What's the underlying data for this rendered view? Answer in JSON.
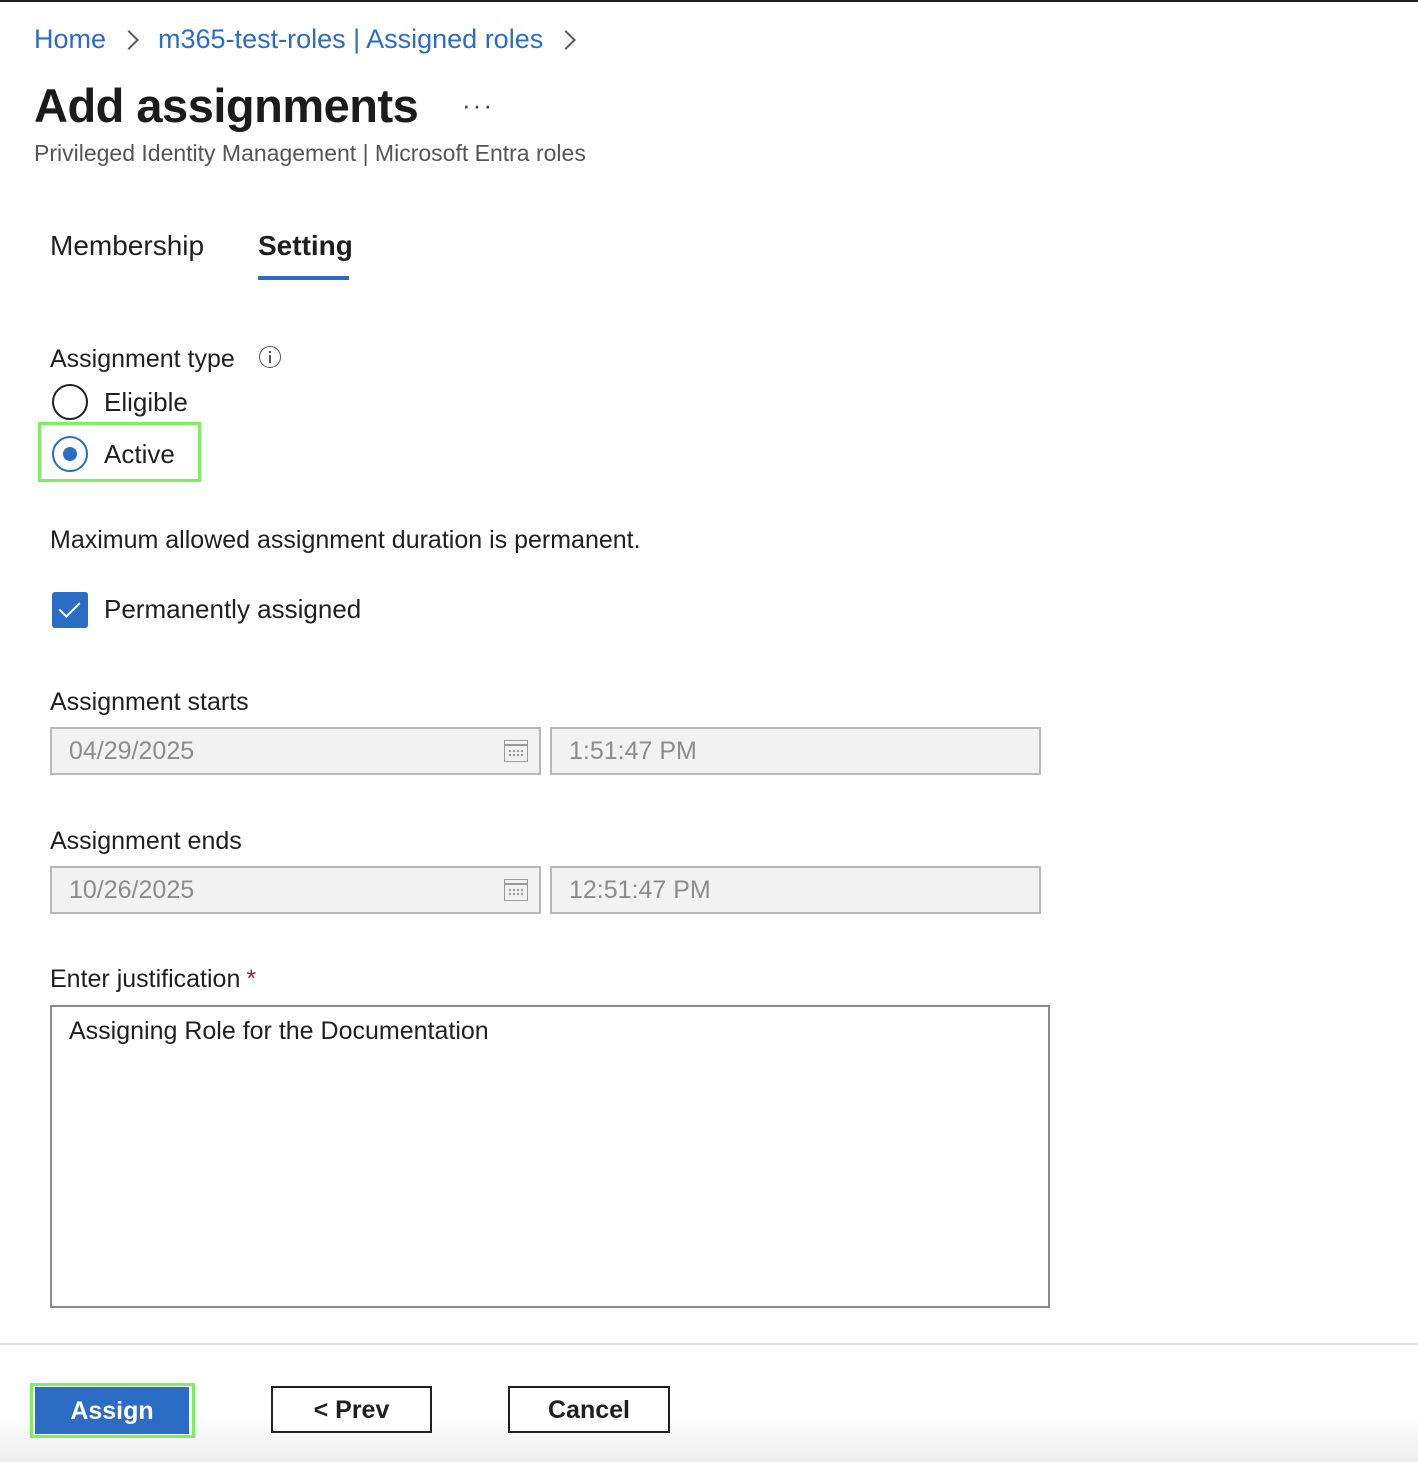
{
  "breadcrumb": {
    "home": "Home",
    "parent": "m365-test-roles | Assigned roles"
  },
  "header": {
    "title": "Add assignments",
    "more": "···",
    "subtitle": "Privileged Identity Management | Microsoft Entra roles"
  },
  "tabs": [
    {
      "label": "Membership",
      "selected": false
    },
    {
      "label": "Setting",
      "selected": true
    }
  ],
  "assignment_type": {
    "label": "Assignment type",
    "options": [
      {
        "label": "Eligible",
        "selected": false
      },
      {
        "label": "Active",
        "selected": true
      }
    ]
  },
  "duration_note": "Maximum allowed assignment duration is permanent.",
  "permanent": {
    "label": "Permanently assigned",
    "checked": true
  },
  "starts": {
    "label": "Assignment starts",
    "date": "04/29/2025",
    "time": "1:51:47 PM"
  },
  "ends": {
    "label": "Assignment ends",
    "date": "10/26/2025",
    "time": "12:51:47 PM"
  },
  "justification": {
    "label": "Enter justification",
    "required_mark": "*",
    "value": "Assigning Role for the Documentation"
  },
  "footer": {
    "assign": "Assign",
    "prev": "< Prev",
    "cancel": "Cancel"
  },
  "colors": {
    "accent": "#2b6cc4",
    "highlight": "#7cf060",
    "required": "#a4262c"
  }
}
